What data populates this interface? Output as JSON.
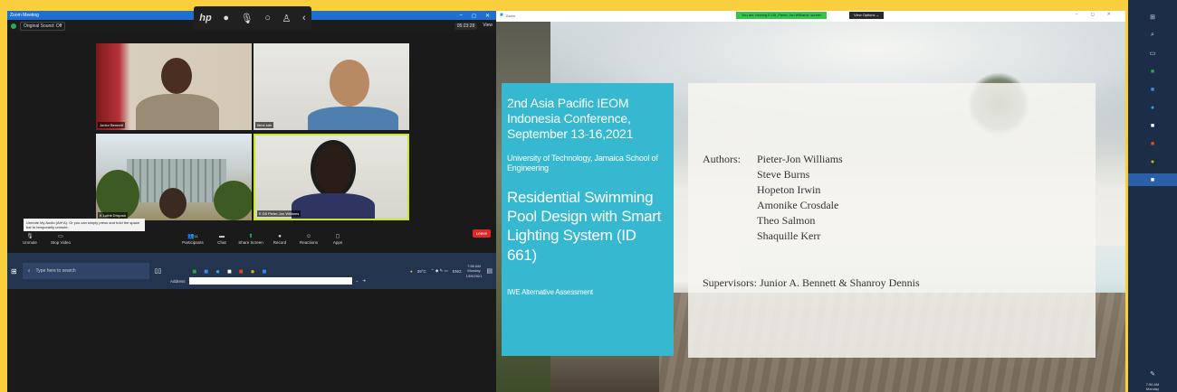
{
  "zoom_window": {
    "title": "Zoom Meeting",
    "window_controls": [
      "–",
      "◻",
      "✕"
    ],
    "audio_button": "Original Sound: Off",
    "timer": "05:23:28",
    "view_button": "View",
    "participants": [
      {
        "name": "Junior Bennett"
      },
      {
        "name": "Ilene sdn"
      },
      {
        "name": "K Luthit Dhiyush"
      },
      {
        "name": "E D5 Pieter-Jon Williams"
      }
    ],
    "tooltip": "Unmute My Audio (Alt+A). Or you can simply press and hold the space bar to temporarily unmute.",
    "controls": {
      "unmute": "Unmute",
      "stop_video": "Stop Video",
      "participants": "Participants",
      "participants_count": "11",
      "chat": "Chat",
      "share_screen": "Share Screen",
      "record": "Record",
      "reactions": "Reactions",
      "apps": "Apps",
      "end": "Leave"
    },
    "taskbar": {
      "search_placeholder": "Type here to search",
      "address_label": "Address",
      "temperature": "29°C",
      "language": "ENG",
      "time": "7:56 AM",
      "day": "Monday",
      "date": "13/9/2021"
    }
  },
  "share_window": {
    "title": "Zoom",
    "viewing_banner": "You are viewing E D5_Pieter-Jon Williams' screen",
    "view_options": "View Options ⌄",
    "window_controls": [
      "–",
      "◻",
      "✕"
    ]
  },
  "slide": {
    "conference": "2nd Asia Pacific IEOM Indonesia Conference, September 13-16,2021",
    "university": "University of Technology, Jamaica School of Engineering",
    "paper_title": "Residential Swimming Pool Design with Smart Lighting System (ID 661)",
    "assessment": "IWE Alternative Assessment",
    "authors_label": "Authors:",
    "authors": [
      "Pieter-Jon Williams",
      "Steve Burns",
      "Hopeton Irwin",
      "Amonike Crosdale",
      "Theo Salmon",
      "Shaquille Kerr"
    ],
    "supervisors": "Supervisors: Junior A. Bennett & Shanroy Dennis",
    "colors": {
      "panel": "#35b8d0",
      "accent_border": "#c8e632"
    }
  },
  "vertical_taskbar": {
    "time": "7:56 AM",
    "day": "Monday"
  }
}
